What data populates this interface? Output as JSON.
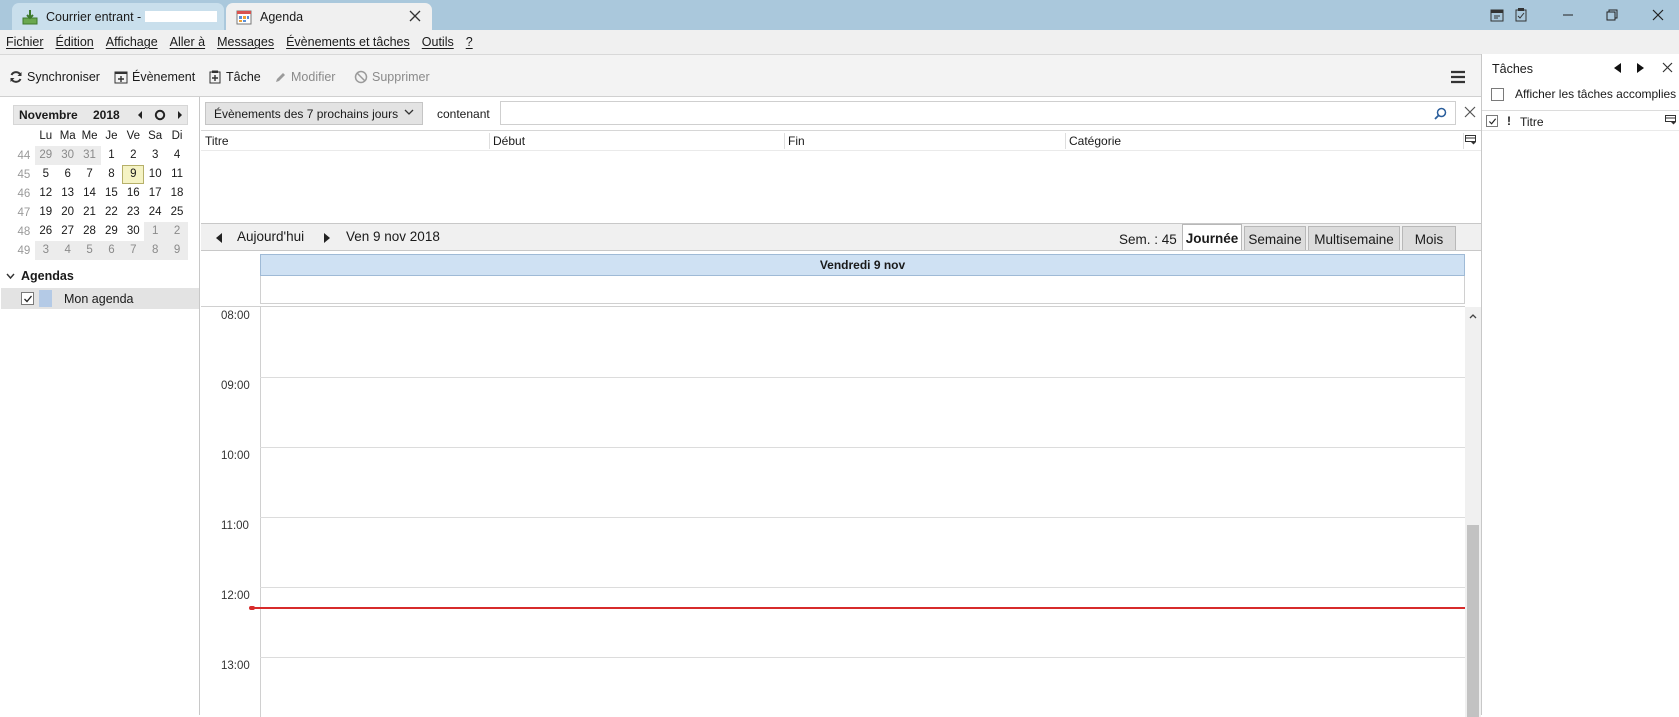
{
  "colors": {
    "titlebar": "#aac8dc",
    "today_highlight": "#f5f3c4",
    "day_header": "#cfe1f3",
    "now_line": "#d72b2b",
    "agenda_color": "#b4cae6"
  },
  "tabs": [
    {
      "label": "Courrier entrant -",
      "icon": "inbox-download-icon"
    },
    {
      "label": "Agenda",
      "icon": "calendar-icon"
    }
  ],
  "menu": [
    "Fichier",
    "Édition",
    "Affichage",
    "Aller à",
    "Messages",
    "Évènements et tâches",
    "Outils",
    "?"
  ],
  "toolbar": {
    "sync": "Synchroniser",
    "event": "Évènement",
    "task": "Tâche",
    "edit": "Modifier",
    "delete": "Supprimer"
  },
  "minical": {
    "month": "Novembre",
    "year": "2018",
    "dow": [
      "Lu",
      "Ma",
      "Me",
      "Je",
      "Ve",
      "Sa",
      "Di"
    ],
    "weeks": [
      {
        "wk": "44",
        "days": [
          "29",
          "30",
          "31",
          "1",
          "2",
          "3",
          "4"
        ]
      },
      {
        "wk": "45",
        "days": [
          "5",
          "6",
          "7",
          "8",
          "9",
          "10",
          "11"
        ]
      },
      {
        "wk": "46",
        "days": [
          "12",
          "13",
          "14",
          "15",
          "16",
          "17",
          "18"
        ]
      },
      {
        "wk": "47",
        "days": [
          "19",
          "20",
          "21",
          "22",
          "23",
          "24",
          "25"
        ]
      },
      {
        "wk": "48",
        "days": [
          "26",
          "27",
          "28",
          "29",
          "30",
          "1",
          "2"
        ]
      },
      {
        "wk": "49",
        "days": [
          "3",
          "4",
          "5",
          "6",
          "7",
          "8",
          "9"
        ]
      }
    ]
  },
  "agendas": {
    "title": "Agendas",
    "items": [
      {
        "name": "Mon agenda",
        "checked": true
      }
    ]
  },
  "filter": {
    "selected": "Évènements des 7 prochains jours",
    "contains_label": "contenant",
    "search_value": ""
  },
  "list_columns": [
    "Titre",
    "Début",
    "Fin",
    "Catégorie"
  ],
  "nav": {
    "today": "Aujourd'hui",
    "current_date": "Ven 9 nov 2018",
    "week": "Sem. : 45",
    "views": [
      "Journée",
      "Semaine",
      "Multisemaine",
      "Mois"
    ],
    "active_view": "Journée"
  },
  "day_view": {
    "header": "Vendredi 9 nov",
    "hours": [
      "08:00",
      "09:00",
      "10:00",
      "11:00",
      "12:00",
      "13:00"
    ],
    "now_time": "12:30"
  },
  "tasks": {
    "title": "Tâches",
    "show_completed": "Afficher les tâches accomplies",
    "show_completed_checked": false,
    "priority_col": "!",
    "title_col": "Titre"
  }
}
